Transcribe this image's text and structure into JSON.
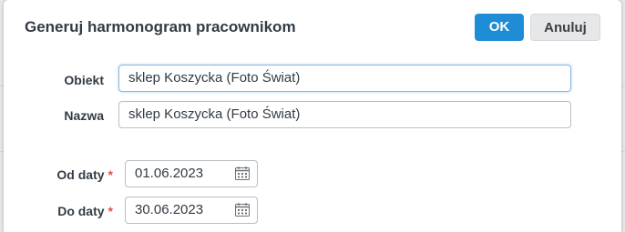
{
  "dialog": {
    "title": "Generuj harmonogram pracownikom",
    "ok_label": "OK",
    "cancel_label": "Anuluj"
  },
  "form": {
    "object_label": "Obiekt",
    "object_value": "sklep Koszycka (Foto Świat)",
    "name_label": "Nazwa",
    "name_value": "sklep Koszycka (Foto Świat)",
    "from_label": "Od daty",
    "from_value": "01.06.2023",
    "to_label": "Do daty",
    "to_value": "30.06.2023",
    "required_marker": "*"
  },
  "colors": {
    "accent": "#1f8dd6",
    "required": "#d9534f"
  },
  "icons": {
    "date_picker": "calendar-icon"
  }
}
